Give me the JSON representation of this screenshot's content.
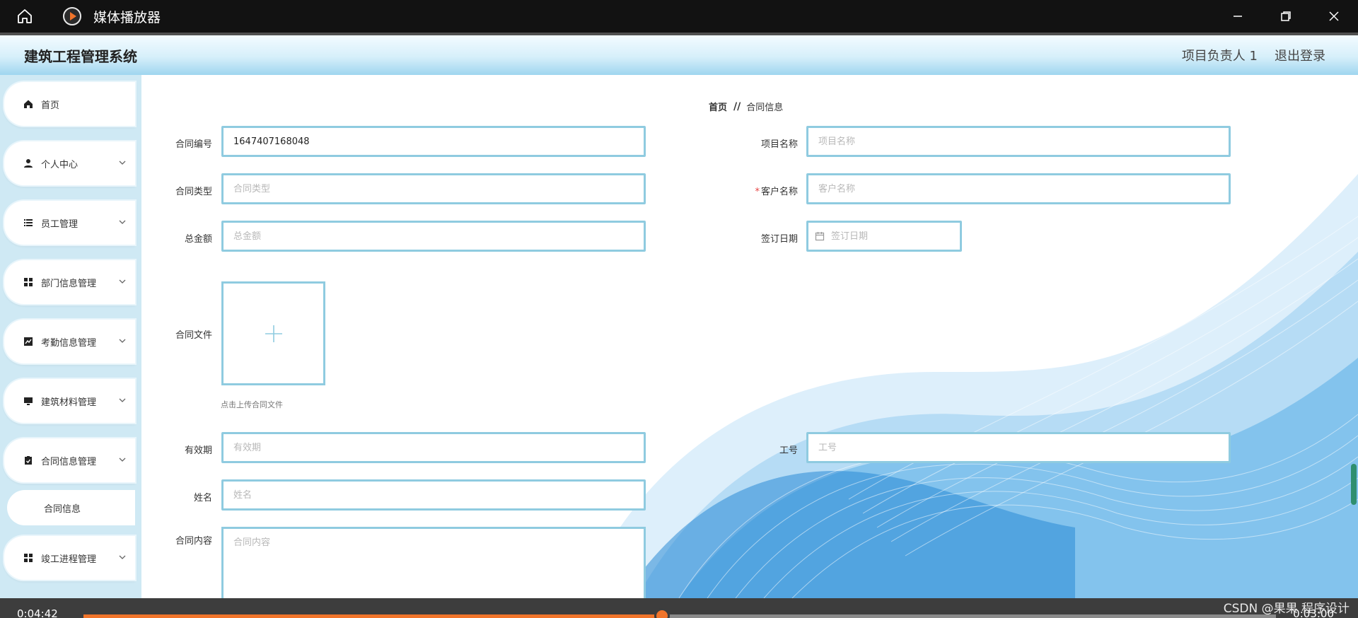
{
  "player": {
    "title": "媒体播放器",
    "current_time": "0:04:42",
    "total_time": "0:03:00",
    "progress_fraction": 0.485,
    "watermark": "CSDN @果果 程序设计"
  },
  "header": {
    "app_title": "建筑工程管理系统",
    "user": "项目负责人 1",
    "logout": "退出登录"
  },
  "sidebar": {
    "items": [
      {
        "label": "首页",
        "icon": "home-icon",
        "has_children": false
      },
      {
        "label": "个人中心",
        "icon": "user-icon",
        "has_children": true
      },
      {
        "label": "员工管理",
        "icon": "list-icon",
        "has_children": true
      },
      {
        "label": "部门信息管理",
        "icon": "grid-icon",
        "has_children": true
      },
      {
        "label": "考勤信息管理",
        "icon": "chart-icon",
        "has_children": true
      },
      {
        "label": "建筑材料管理",
        "icon": "monitor-icon",
        "has_children": true
      },
      {
        "label": "合同信息管理",
        "icon": "clipboard-icon",
        "has_children": true
      },
      {
        "label": "竣工进程管理",
        "icon": "grid-icon",
        "has_children": true
      }
    ],
    "submenu": {
      "label": "合同信息"
    }
  },
  "breadcrumb": {
    "home": "首页",
    "separator": "//",
    "current": "合同信息"
  },
  "form": {
    "contract_no": {
      "label": "合同编号",
      "value": "1647407168048",
      "placeholder": ""
    },
    "project_name": {
      "label": "项目名称",
      "value": "",
      "placeholder": "项目名称"
    },
    "contract_type": {
      "label": "合同类型",
      "value": "",
      "placeholder": "合同类型"
    },
    "customer_name": {
      "label": "客户名称",
      "value": "",
      "placeholder": "客户名称",
      "required_mark": "*"
    },
    "total_amount": {
      "label": "总金额",
      "value": "",
      "placeholder": "总金额"
    },
    "sign_date": {
      "label": "签订日期",
      "value": "",
      "placeholder": "签订日期"
    },
    "contract_file": {
      "label": "合同文件",
      "upload_hint": "点击上传合同文件"
    },
    "validity": {
      "label": "有效期",
      "value": "",
      "placeholder": "有效期"
    },
    "employee_no": {
      "label": "工号",
      "value": "",
      "placeholder": "工号"
    },
    "name": {
      "label": "姓名",
      "value": "",
      "placeholder": "姓名"
    },
    "content": {
      "label": "合同内容",
      "value": "",
      "placeholder": "合同内容"
    }
  },
  "colors": {
    "accent_border": "#8fcbe0",
    "sidebar_bg": "#cfe9f4",
    "progress": "#f0742a",
    "required": "#e64545"
  }
}
